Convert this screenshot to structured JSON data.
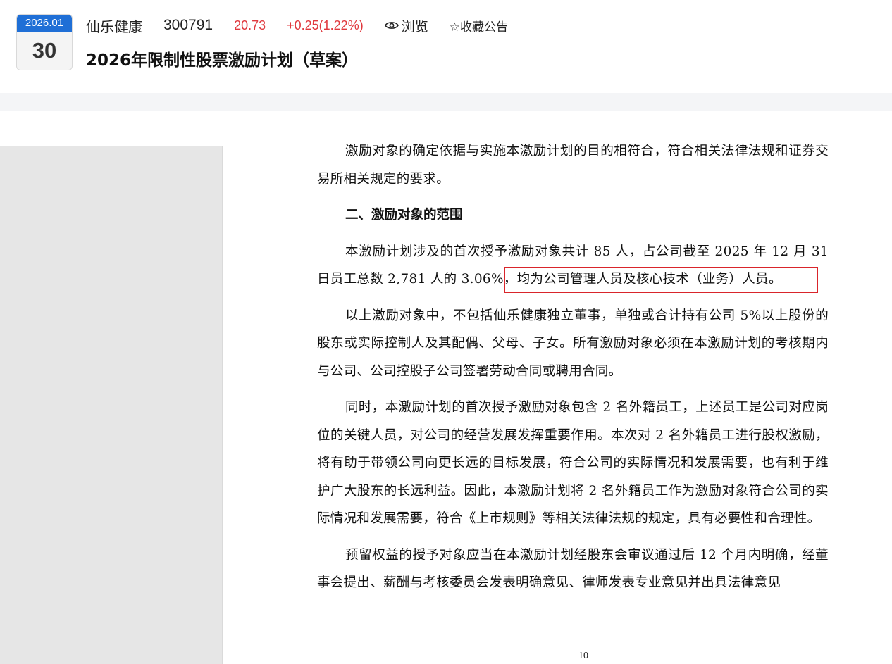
{
  "header": {
    "date_month": "2026.01",
    "date_day": "30",
    "company": "仙乐健康",
    "stock_code": "300791",
    "price": "20.73",
    "change": "+0.25(1.22%)",
    "view_label": "浏览",
    "favorite_label": "☆收藏公告",
    "title": "2026年限制性股票激励计划（草案）"
  },
  "colors": {
    "accent_blue": "#1f6fd6",
    "price_red": "#e0393e",
    "highlight_red": "#d9252b"
  },
  "document": {
    "para1": "激励对象的确定依据与实施本激励计划的目的相符合，符合相关法律法规和证券交易所相关规定的要求。",
    "heading2": "二、激励对象的范围",
    "para2": "本激励计划涉及的首次授予激励对象共计 85 人，占公司截至 2025 年 12 月 31 日员工总数 2,781 人的 3.06%，均为公司管理人员及核心技术（业务）人员。",
    "para3": "以上激励对象中，不包括仙乐健康独立董事，单独或合计持有公司 5%以上股份的股东或实际控制人及其配偶、父母、子女。所有激励对象必须在本激励计划的考核期内与公司、公司控股子公司签署劳动合同或聘用合同。",
    "para4": "同时，本激励计划的首次授予激励对象包含 2 名外籍员工，上述员工是公司对应岗位的关键人员，对公司的经营发展发挥重要作用。本次对 2 名外籍员工进行股权激励，将有助于带领公司向更长远的目标发展，符合公司的实际情况和发展需要，也有利于维护广大股东的长远利益。因此，本激励计划将 2 名外籍员工作为激励对象符合公司的实际情况和发展需要，符合《上市规则》等相关法律法规的规定，具有必要性和合理性。",
    "para5": "预留权益的授予对象应当在本激励计划经股东会审议通过后 12 个月内明确，经董事会提出、薪酬与考核委员会发表明确意见、律师发表专业意见并出具法律意见",
    "page_number": "10"
  }
}
